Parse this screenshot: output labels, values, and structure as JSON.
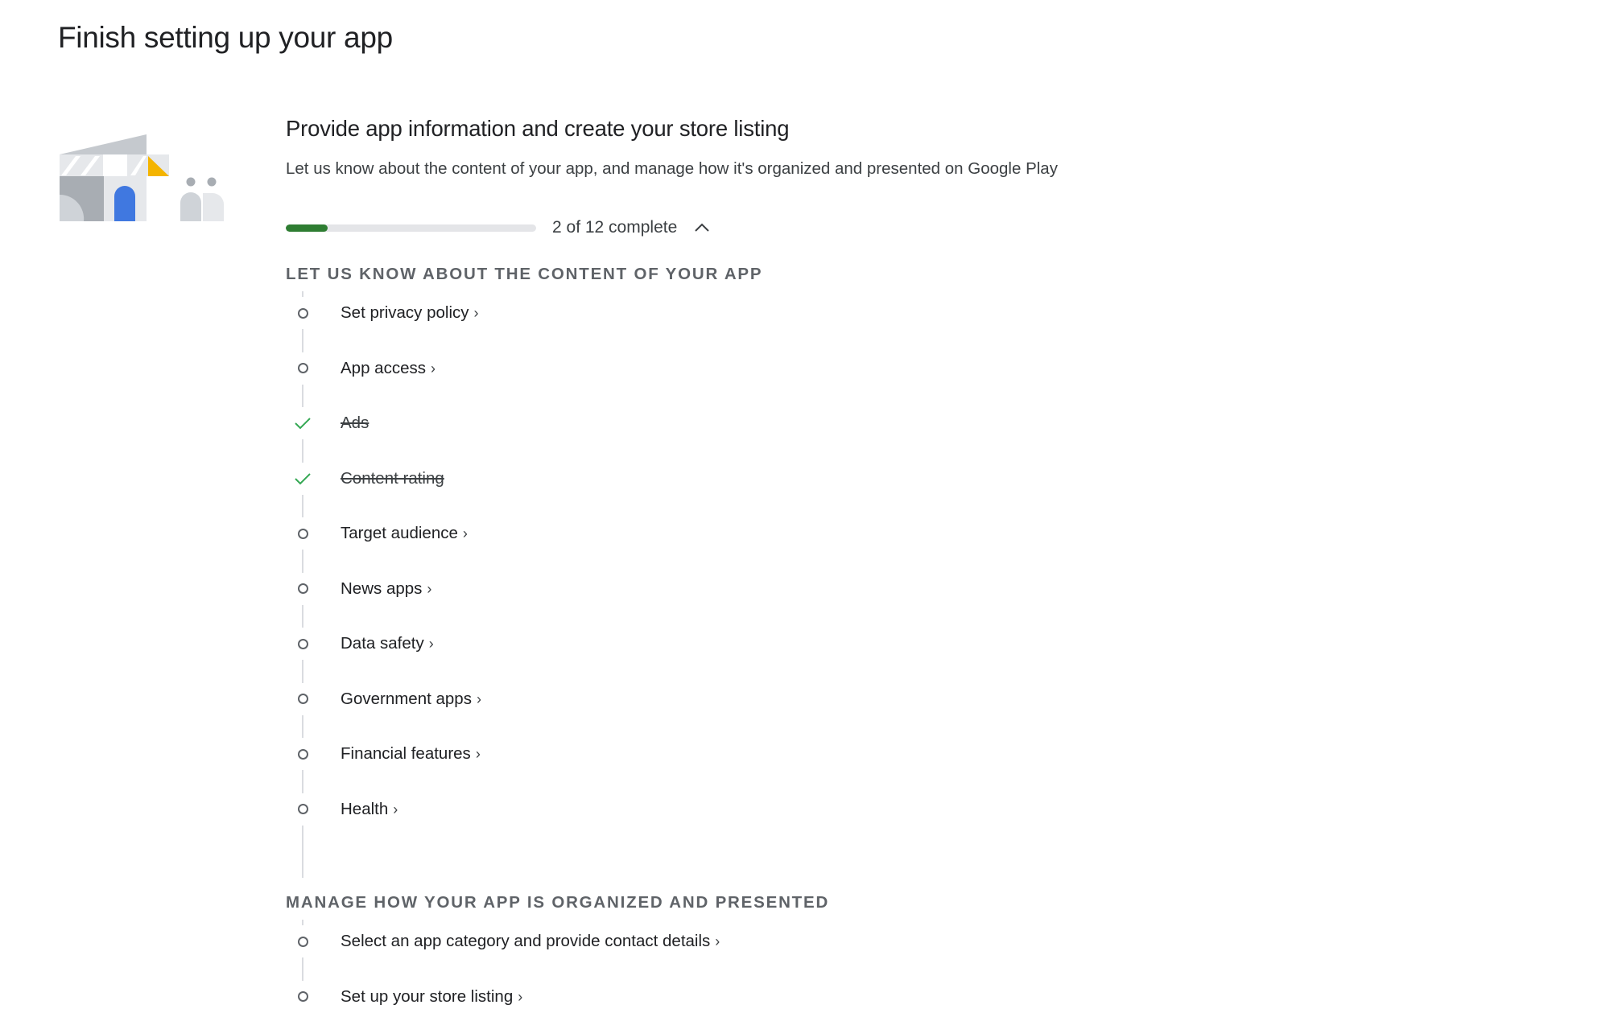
{
  "page": {
    "title": "Finish setting up your app"
  },
  "card": {
    "title": "Provide app information and create your store listing",
    "subtitle": "Let us know about the content of your app, and manage how it's organized and presented on Google Play",
    "progress": {
      "completed": 2,
      "total": 12,
      "fraction": 0.1667,
      "label": "2 of 12 complete",
      "toggle_icon": "chevron-up-icon",
      "fill_color": "#2e7d32",
      "track_color": "#e4e5e8"
    },
    "sections": [
      {
        "header": "Let us know about the content of your app",
        "tasks": [
          {
            "label": "Set privacy policy",
            "status": "incomplete",
            "chevron": "›"
          },
          {
            "label": "App access",
            "status": "incomplete",
            "chevron": "›"
          },
          {
            "label": "Ads",
            "status": "complete",
            "chevron": ""
          },
          {
            "label": "Content rating",
            "status": "complete",
            "chevron": ""
          },
          {
            "label": "Target audience",
            "status": "incomplete",
            "chevron": "›"
          },
          {
            "label": "News apps",
            "status": "incomplete",
            "chevron": "›"
          },
          {
            "label": "Data safety",
            "status": "incomplete",
            "chevron": "›"
          },
          {
            "label": "Government apps",
            "status": "incomplete",
            "chevron": "›"
          },
          {
            "label": "Financial features",
            "status": "incomplete",
            "chevron": "›"
          },
          {
            "label": "Health",
            "status": "incomplete",
            "chevron": "›"
          }
        ]
      },
      {
        "header": "Manage how your app is organized and presented",
        "tasks": [
          {
            "label": "Select an app category and provide contact details",
            "status": "incomplete",
            "chevron": "›"
          },
          {
            "label": "Set up your store listing",
            "status": "incomplete",
            "chevron": "›"
          }
        ]
      }
    ]
  },
  "colors": {
    "check": "#34a853",
    "accent_blue": "#4078e0",
    "accent_yellow": "#f4b400"
  }
}
